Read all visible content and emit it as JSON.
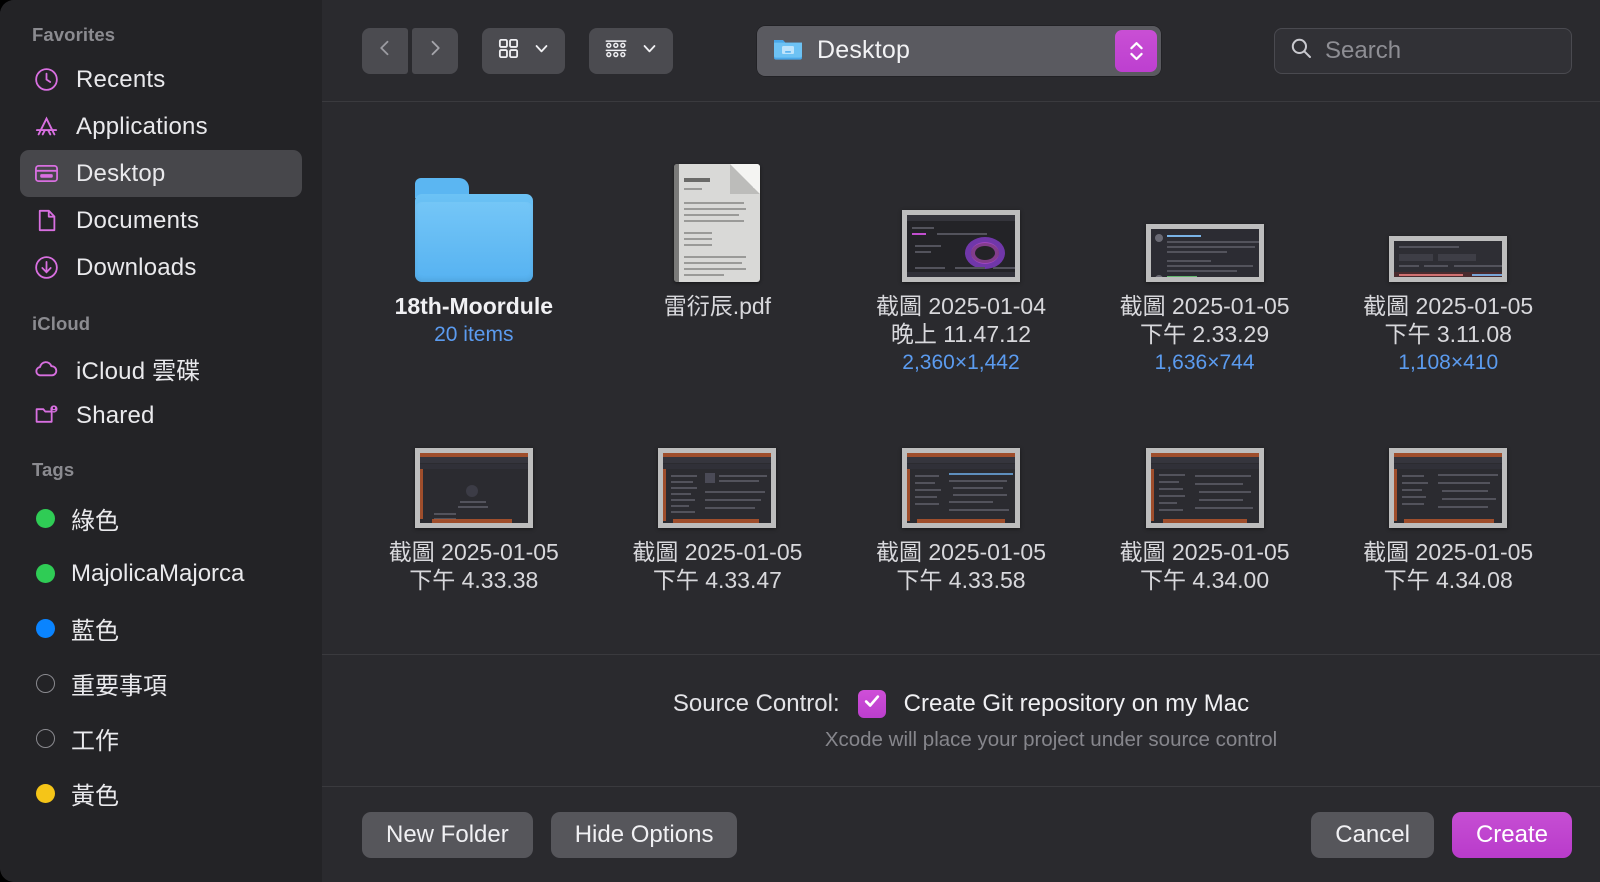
{
  "sidebar": {
    "sections": [
      {
        "header": "Favorites",
        "items": [
          {
            "label": "Recents",
            "icon": "clock-icon",
            "selected": false
          },
          {
            "label": "Applications",
            "icon": "applications-icon",
            "selected": false
          },
          {
            "label": "Desktop",
            "icon": "desktop-icon",
            "selected": true
          },
          {
            "label": "Documents",
            "icon": "document-icon",
            "selected": false
          },
          {
            "label": "Downloads",
            "icon": "downloads-icon",
            "selected": false
          }
        ]
      },
      {
        "header": "iCloud",
        "items": [
          {
            "label": "iCloud 雲碟",
            "icon": "cloud-icon",
            "selected": false
          },
          {
            "label": "Shared",
            "icon": "shared-folder-icon",
            "selected": false
          }
        ]
      }
    ],
    "tags_header": "Tags",
    "tags": [
      {
        "label": "綠色",
        "color": "#2fcc55"
      },
      {
        "label": "MajolicaMajorca",
        "color": "#2fcc55"
      },
      {
        "label": "藍色",
        "color": "#0a84ff"
      },
      {
        "label": "重要事項",
        "color": "hollow"
      },
      {
        "label": "工作",
        "color": "hollow"
      },
      {
        "label": "黃色",
        "color": "#f5c518"
      }
    ]
  },
  "toolbar": {
    "back_icon": "chevron-left-icon",
    "forward_icon": "chevron-right-icon",
    "view_icon": "icon-view-grid-icon",
    "view_chevron_icon": "chevron-down-icon",
    "group_icon": "group-by-icon",
    "group_chevron_icon": "chevron-down-icon",
    "path_icon": "desktop-folder-icon",
    "path_label": "Desktop",
    "stepper_icon": "up-down-stepper-icon",
    "search_icon": "search-icon",
    "search_placeholder": "Search",
    "search_value": ""
  },
  "files": [
    {
      "name": "18th-Moordule",
      "sub": "20 items",
      "kind": "folder",
      "bright": true
    },
    {
      "name": "雷衍辰.pdf",
      "sub": "",
      "kind": "pdf",
      "bright": false
    },
    {
      "name_line1": "截圖 2025-01-04",
      "name_line2": "晚上 11.47.12",
      "sub": "2,360×1,442",
      "kind": "shot-dashboard",
      "bright": false
    },
    {
      "name_line1": "截圖 2025-01-05",
      "name_line2": "下午 2.33.29",
      "sub": "1,636×744",
      "kind": "shot-chat",
      "bright": false
    },
    {
      "name_line1": "截圖 2025-01-05",
      "name_line2": "下午 3.11.08",
      "sub": "1,108×410",
      "kind": "shot-devtools",
      "bright": false
    },
    {
      "name_line1": "截圖 2025-01-05",
      "name_line2": "下午 4.33.38",
      "sub": "",
      "kind": "shot-ide-a",
      "bright": false
    },
    {
      "name_line1": "截圖 2025-01-05",
      "name_line2": "下午 4.33.47",
      "sub": "",
      "kind": "shot-ide-b",
      "bright": false
    },
    {
      "name_line1": "截圖 2025-01-05",
      "name_line2": "下午 4.33.58",
      "sub": "",
      "kind": "shot-ide-c",
      "bright": false
    },
    {
      "name_line1": "截圖 2025-01-05",
      "name_line2": "下午 4.34.00",
      "sub": "",
      "kind": "shot-ide-d",
      "bright": false
    },
    {
      "name_line1": "截圖 2025-01-05",
      "name_line2": "下午 4.34.08",
      "sub": "",
      "kind": "shot-ide-e",
      "bright": false
    }
  ],
  "options": {
    "source_control_label": "Source Control:",
    "checkbox_label": "Create Git repository on my Mac",
    "checkbox_checked": true,
    "check_icon": "checkmark-icon",
    "hint": "Xcode will place your project under source control"
  },
  "buttons": {
    "new_folder": "New Folder",
    "hide_options": "Hide Options",
    "cancel": "Cancel",
    "create": "Create"
  },
  "colors": {
    "accent": "#c24ecf",
    "sidebar_icon": "#d86fe0",
    "link_blue": "#5b9bef",
    "window_bg": "#2a2a2e",
    "sidebar_bg": "#232326"
  }
}
